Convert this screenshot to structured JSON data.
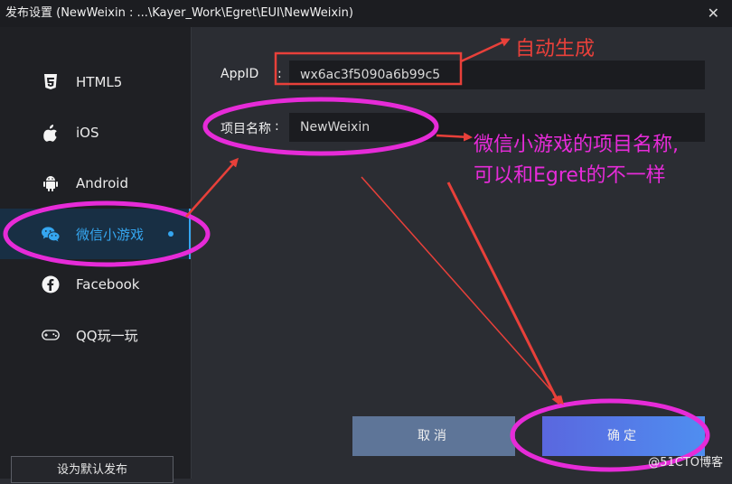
{
  "window": {
    "title": "发布设置 (NewWeixin : ...\\Kayer_Work\\Egret\\EUI\\NewWeixin)",
    "close_label": "✕"
  },
  "sidebar": {
    "items": [
      {
        "label": "HTML5",
        "icon": "html5-icon"
      },
      {
        "label": "iOS",
        "icon": "apple-icon"
      },
      {
        "label": "Android",
        "icon": "android-icon"
      },
      {
        "label": "微信小游戏",
        "icon": "wechat-icon",
        "active": true
      },
      {
        "label": "Facebook",
        "icon": "facebook-icon"
      },
      {
        "label": "QQ玩一玩",
        "icon": "gamepad-icon"
      }
    ],
    "set_default_label": "设为默认发布"
  },
  "form": {
    "appid_label": "AppID",
    "appid_colon": ":",
    "appid_value": "wx6ac3f5090a6b99c5",
    "project_label": "项目名称",
    "project_colon": ":",
    "project_value": "NewWeixin"
  },
  "buttons": {
    "cancel": "取消",
    "confirm": "确定"
  },
  "annotations": {
    "auto_generate": "自动生成",
    "project_note_line1": "微信小游戏的项目名称,",
    "project_note_line2": "可以和Egret的不一样",
    "highlight_color": "#e62bd8",
    "red_color": "#e8403a"
  },
  "watermark": "@51CTO博客"
}
